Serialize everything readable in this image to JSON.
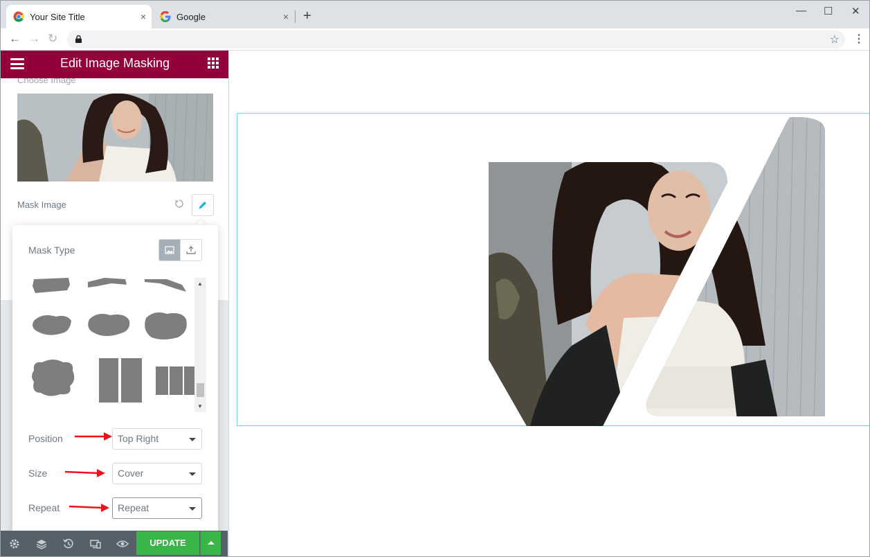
{
  "browser": {
    "tabs": [
      {
        "title": "Your Site Title",
        "active": true,
        "icon": "chrome-icon"
      },
      {
        "title": "Google",
        "active": false,
        "icon": "google-icon"
      }
    ],
    "new_tab_symbol": "+",
    "close_symbol": "×",
    "window_controls": {
      "minimize": "—",
      "maximize": "☐",
      "close": "✕"
    },
    "nav": {
      "back": "←",
      "forward": "→",
      "reload": "↻"
    },
    "address": "",
    "bookmark_symbol": "☆",
    "menu_symbol": "⋮"
  },
  "panel": {
    "title": "Edit Image Masking",
    "choose_image_label": "Choose Image",
    "mask_image_label": "Mask Image",
    "mask_type_label": "Mask Type",
    "mask_type_options": [
      "image-icon",
      "upload-icon"
    ],
    "mask_type_selected": "image-icon",
    "position": {
      "label": "Position",
      "value": "Top Right"
    },
    "size": {
      "label": "Size",
      "value": "Cover"
    },
    "repeat": {
      "label": "Repeat",
      "value": "Repeat"
    },
    "update_label": "UPDATE",
    "footer_icons": [
      "settings-icon",
      "layers-icon",
      "history-icon",
      "responsive-icon",
      "preview-eye-icon"
    ]
  },
  "colors": {
    "header_bg": "#93003c",
    "update_green": "#39b54a",
    "footer_bg": "#556068",
    "outline_cyan": "#71d7f7",
    "annotation_red": "#e8141a"
  }
}
